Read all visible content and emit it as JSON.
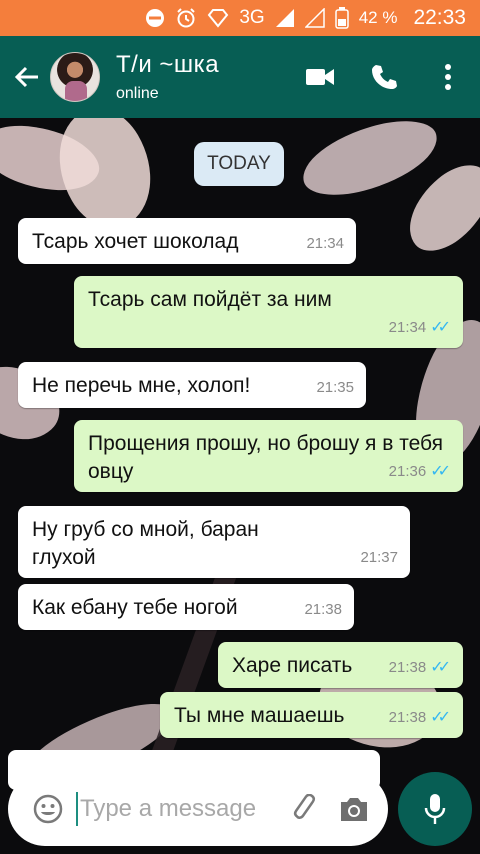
{
  "status": {
    "network": "3G",
    "battery": "42 %",
    "time": "22:33"
  },
  "header": {
    "title": "Т/и ~шка",
    "subtitle": "online"
  },
  "chat": {
    "day_label": "TODAY"
  },
  "messages": [
    {
      "text": "Тсарь хочет шоколад",
      "time": "21:34",
      "dir": "in"
    },
    {
      "text": "Тсарь сам пойдёт за ним",
      "time": "21:34",
      "dir": "out"
    },
    {
      "text": "Не перечь мне, холоп!",
      "time": "21:35",
      "dir": "in"
    },
    {
      "text": "Прощения прошу, но брошу я в тебя овцу",
      "time": "21:36",
      "dir": "out"
    },
    {
      "text": "Ну груб со мной, баран глухой",
      "time": "21:37",
      "dir": "in"
    },
    {
      "text": "Как ебану тебе ногой",
      "time": "21:38",
      "dir": "in"
    },
    {
      "text": "Харе писать",
      "time": "21:38",
      "dir": "out"
    },
    {
      "text": "Ты мне машаешь",
      "time": "21:38",
      "dir": "out"
    }
  ],
  "composer": {
    "placeholder": "Type a message"
  },
  "colors": {
    "header": "#075e54",
    "statusbar": "#f47e3c",
    "outgoing": "#dcf8c6",
    "incoming": "#ffffff",
    "ticks": "#34b7f1"
  }
}
